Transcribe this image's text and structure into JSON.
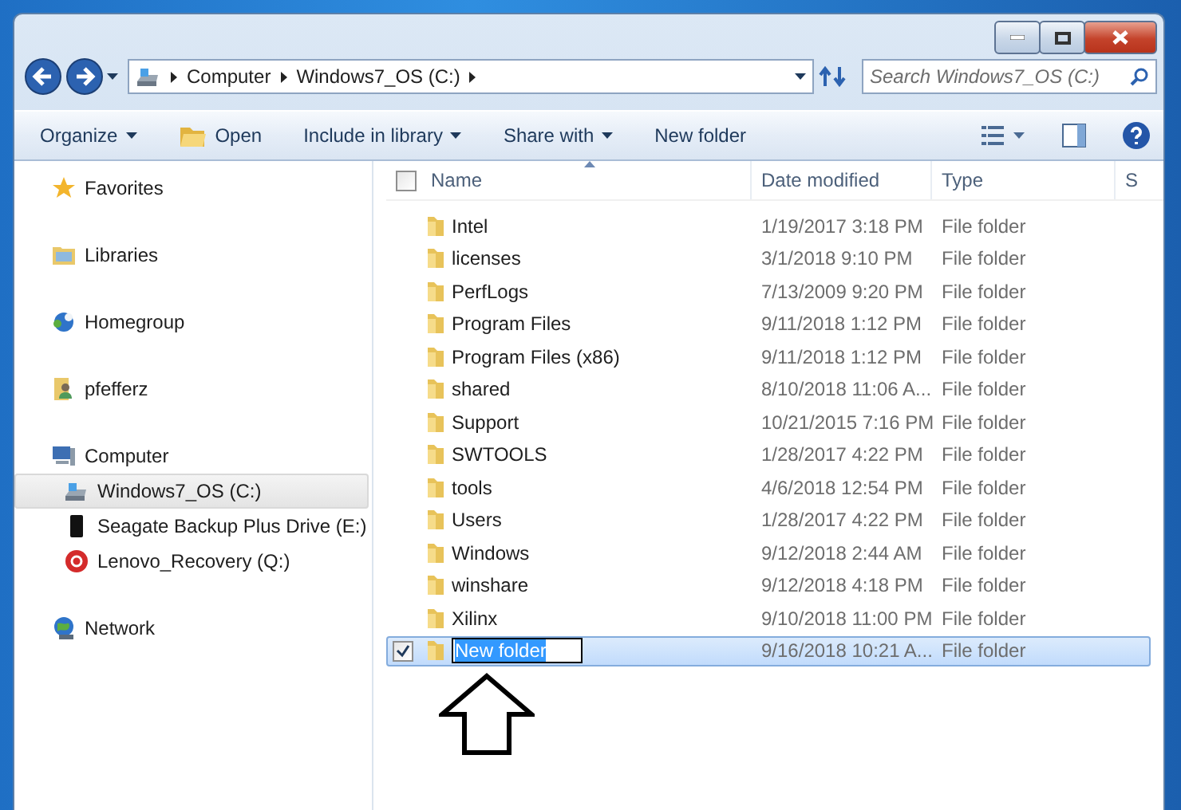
{
  "window": {
    "breadcrumb": [
      "Computer",
      "Windows7_OS (C:)"
    ],
    "search": {
      "placeholder": "Search Windows7_OS (C:)"
    }
  },
  "toolbar": {
    "items": [
      {
        "label": "Organize",
        "kind": "menu"
      },
      {
        "label": "Open",
        "kind": "open"
      },
      {
        "label": "Include in library",
        "kind": "menu"
      },
      {
        "label": "Share with",
        "kind": "menu"
      },
      {
        "label": "New folder",
        "kind": "plain"
      }
    ]
  },
  "sidebar": {
    "items": [
      {
        "label": "Favorites",
        "kind": "star",
        "selected": false
      },
      {
        "label": "Libraries",
        "kind": "library",
        "selected": false
      },
      {
        "label": "Homegroup",
        "kind": "homegroup",
        "selected": false
      },
      {
        "label": "pfefferz",
        "kind": "user",
        "selected": false
      },
      {
        "label": "Computer",
        "kind": "computer",
        "selected": false,
        "children": [
          {
            "label": "Windows7_OS (C:)",
            "kind": "drive",
            "selected": true
          },
          {
            "label": "Seagate Backup Plus Drive (E:)",
            "kind": "external-drive",
            "selected": false
          },
          {
            "label": "Lenovo_Recovery (Q:)",
            "kind": "recovery",
            "selected": false
          }
        ]
      },
      {
        "label": "Network",
        "kind": "network",
        "selected": false
      }
    ]
  },
  "table": {
    "columns": [
      "Name",
      "Date modified",
      "Type",
      "S"
    ],
    "select_all": {
      "checked": false
    },
    "rows": [
      {
        "name": "Intel",
        "date": "1/19/2017 3:18 PM",
        "type": "File folder",
        "selected": false,
        "editing": false
      },
      {
        "name": "licenses",
        "date": "3/1/2018 9:10 PM",
        "type": "File folder",
        "selected": false,
        "editing": false
      },
      {
        "name": "PerfLogs",
        "date": "7/13/2009 9:20 PM",
        "type": "File folder",
        "selected": false,
        "editing": false
      },
      {
        "name": "Program Files",
        "date": "9/11/2018 1:12 PM",
        "type": "File folder",
        "selected": false,
        "editing": false
      },
      {
        "name": "Program Files (x86)",
        "date": "9/11/2018 1:12 PM",
        "type": "File folder",
        "selected": false,
        "editing": false
      },
      {
        "name": "shared",
        "date": "8/10/2018 11:06 A...",
        "type": "File folder",
        "selected": false,
        "editing": false
      },
      {
        "name": "Support",
        "date": "10/21/2015 7:16 PM",
        "type": "File folder",
        "selected": false,
        "editing": false
      },
      {
        "name": "SWTOOLS",
        "date": "1/28/2017 4:22 PM",
        "type": "File folder",
        "selected": false,
        "editing": false
      },
      {
        "name": "tools",
        "date": "4/6/2018 12:54 PM",
        "type": "File folder",
        "selected": false,
        "editing": false
      },
      {
        "name": "Users",
        "date": "1/28/2017 4:22 PM",
        "type": "File folder",
        "selected": false,
        "editing": false
      },
      {
        "name": "Windows",
        "date": "9/12/2018 2:44 AM",
        "type": "File folder",
        "selected": false,
        "editing": false
      },
      {
        "name": "winshare",
        "date": "9/12/2018 4:18 PM",
        "type": "File folder",
        "selected": false,
        "editing": false
      },
      {
        "name": "Xilinx",
        "date": "9/10/2018 11:00 PM",
        "type": "File folder",
        "selected": false,
        "editing": false
      },
      {
        "name": "New folder",
        "date": "9/16/2018 10:21 A...",
        "type": "File folder",
        "selected": true,
        "editing": true
      }
    ]
  }
}
